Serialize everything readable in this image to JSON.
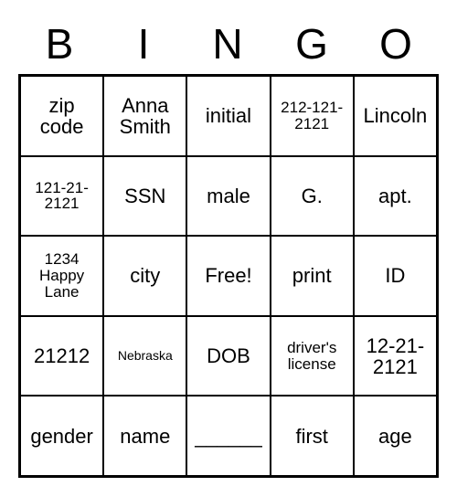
{
  "header": [
    "B",
    "I",
    "N",
    "G",
    "O"
  ],
  "cells": [
    {
      "text": "zip code",
      "size": "normal"
    },
    {
      "text": "Anna Smith",
      "size": "normal"
    },
    {
      "text": "initial",
      "size": "normal"
    },
    {
      "text": "212-121-2121",
      "size": "small"
    },
    {
      "text": "Lincoln",
      "size": "normal"
    },
    {
      "text": "121-21-2121",
      "size": "small"
    },
    {
      "text": "SSN",
      "size": "normal"
    },
    {
      "text": "male",
      "size": "normal"
    },
    {
      "text": "G.",
      "size": "normal"
    },
    {
      "text": "apt.",
      "size": "normal"
    },
    {
      "text": "1234 Happy Lane",
      "size": "small"
    },
    {
      "text": "city",
      "size": "normal"
    },
    {
      "text": "Free!",
      "size": "normal"
    },
    {
      "text": "print",
      "size": "normal"
    },
    {
      "text": "ID",
      "size": "normal"
    },
    {
      "text": "21212",
      "size": "normal"
    },
    {
      "text": "Nebraska",
      "size": "smaller"
    },
    {
      "text": "DOB",
      "size": "normal"
    },
    {
      "text": "driver's license",
      "size": "small"
    },
    {
      "text": "12-21-2121",
      "size": "normal"
    },
    {
      "text": "gender",
      "size": "normal"
    },
    {
      "text": "name",
      "size": "normal"
    },
    {
      "text": "______",
      "size": "normal"
    },
    {
      "text": "first",
      "size": "normal"
    },
    {
      "text": "age",
      "size": "normal"
    }
  ]
}
